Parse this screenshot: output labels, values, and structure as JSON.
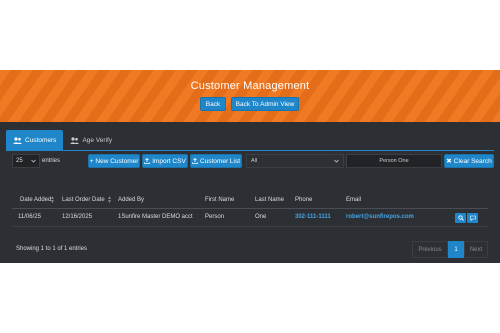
{
  "header": {
    "title": "Customer Management",
    "back_label": "Back",
    "back_admin_label": "Back To Admin View"
  },
  "tabs": [
    {
      "label": "Customers",
      "icon": "users-icon",
      "active": true
    },
    {
      "label": "Age Verify",
      "icon": "users-icon",
      "active": false
    }
  ],
  "toolbar": {
    "page_size": "25",
    "entries_label": "entries",
    "new_customer_label": "New Customer",
    "import_csv_label": "Import CSV",
    "customer_list_label": "Customer List",
    "filter_value": "All",
    "search_value": "Person One",
    "clear_search_label": "Clear Search"
  },
  "table": {
    "headers": [
      "Date Added",
      "Last Order Date",
      "Added By",
      "First Name",
      "Last Name",
      "Phone",
      "Email"
    ],
    "rows": [
      {
        "date_added": "11/06/25",
        "last_order_date": "12/16/2025",
        "added_by": "1Sunfire Master DEMO acct",
        "first_name": "Person",
        "last_name": "One",
        "phone": "302-111-1111",
        "email": "robert@sunfirepos.com"
      }
    ]
  },
  "footer": {
    "info": "Showing 1 to 1 of 1 entries",
    "previous_label": "Previous",
    "current_page": "1",
    "next_label": "Next"
  },
  "colors": {
    "accent": "#1f87c9",
    "banner": "#f07a24",
    "background": "#2c2f33",
    "link": "#42a5e8"
  }
}
